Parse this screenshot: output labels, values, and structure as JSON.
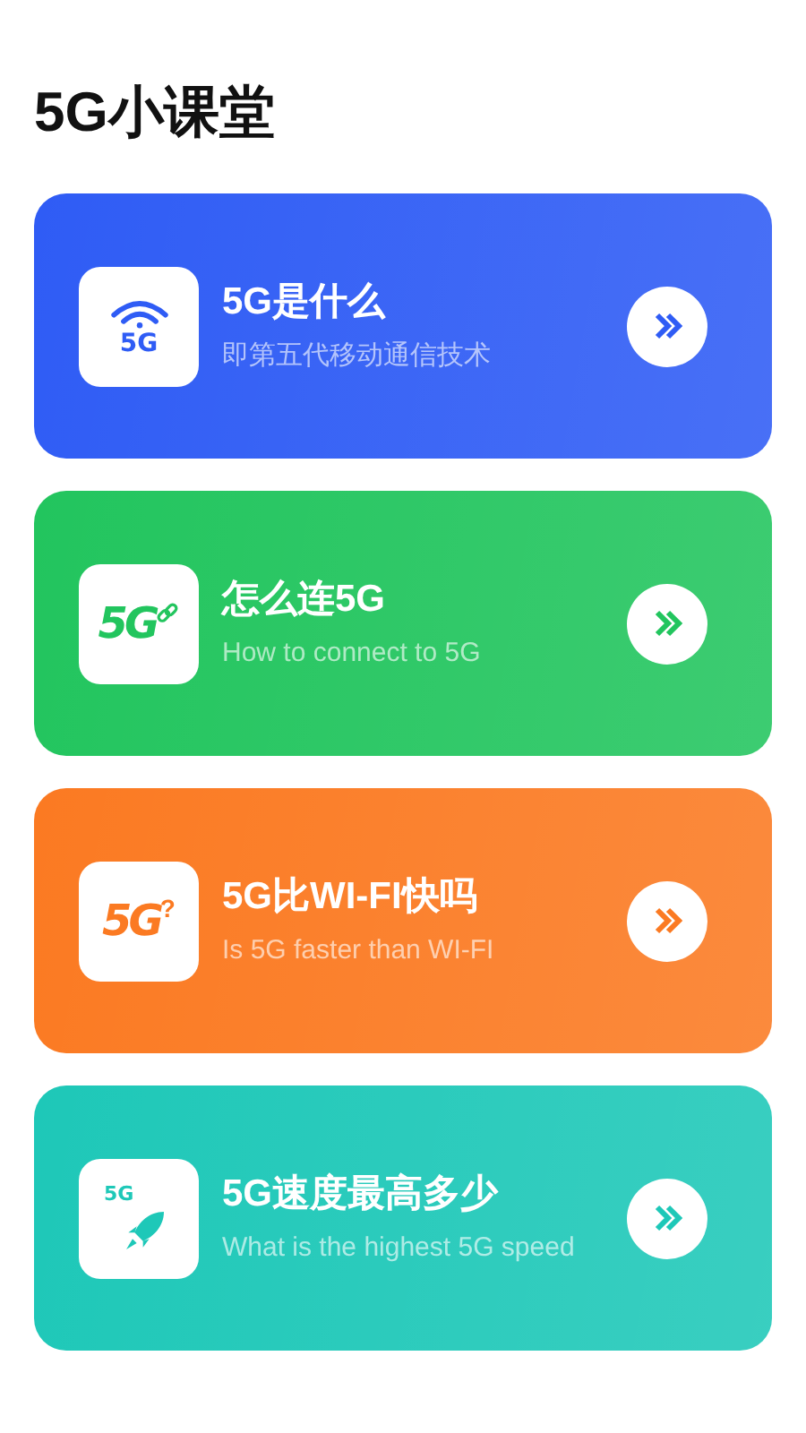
{
  "title": "5G小课堂",
  "cards": [
    {
      "kind": "wifi",
      "icon_text": "5G",
      "title": "5G是什么",
      "subtitle": "即第五代移动通信技术",
      "color": "#2f5cf5"
    },
    {
      "kind": "link",
      "icon_text": "5G",
      "title": "怎么连5G",
      "subtitle": "How to connect to 5G",
      "color": "#22c55e"
    },
    {
      "kind": "question",
      "icon_text": "5G",
      "icon_mark": "?",
      "title": "5G比WI-FI快吗",
      "subtitle": "Is 5G faster than WI-FI",
      "color": "#fb7a22"
    },
    {
      "kind": "rocket",
      "icon_text": "5G",
      "title": "5G速度最高多少",
      "subtitle": "What is the highest 5G speed",
      "color": "#1ec8b8"
    }
  ]
}
